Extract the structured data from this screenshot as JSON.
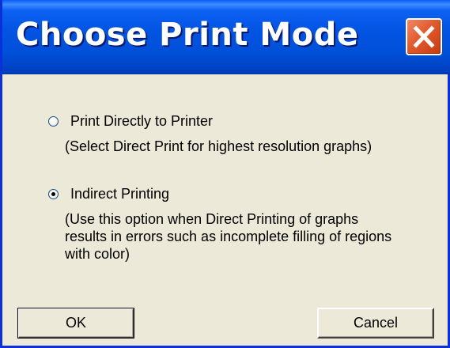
{
  "window": {
    "title": "Choose Print Mode"
  },
  "options": [
    {
      "label": "Print Directly to Printer",
      "description": "(Select Direct Print for highest resolution graphs)",
      "selected": false
    },
    {
      "label": "Indirect Printing",
      "description": "(Use this option when Direct Printing of graphs results in errors such as incomplete filling of regions with color)",
      "selected": true
    }
  ],
  "buttons": {
    "ok_label": "OK",
    "cancel_label": "Cancel"
  },
  "colors": {
    "titlebar": "#0354e3",
    "window_frame": "#0831d9",
    "dialog_bg": "#ece9d8",
    "close_button": "#e15a2c"
  },
  "icons": {
    "close": "close-icon"
  }
}
